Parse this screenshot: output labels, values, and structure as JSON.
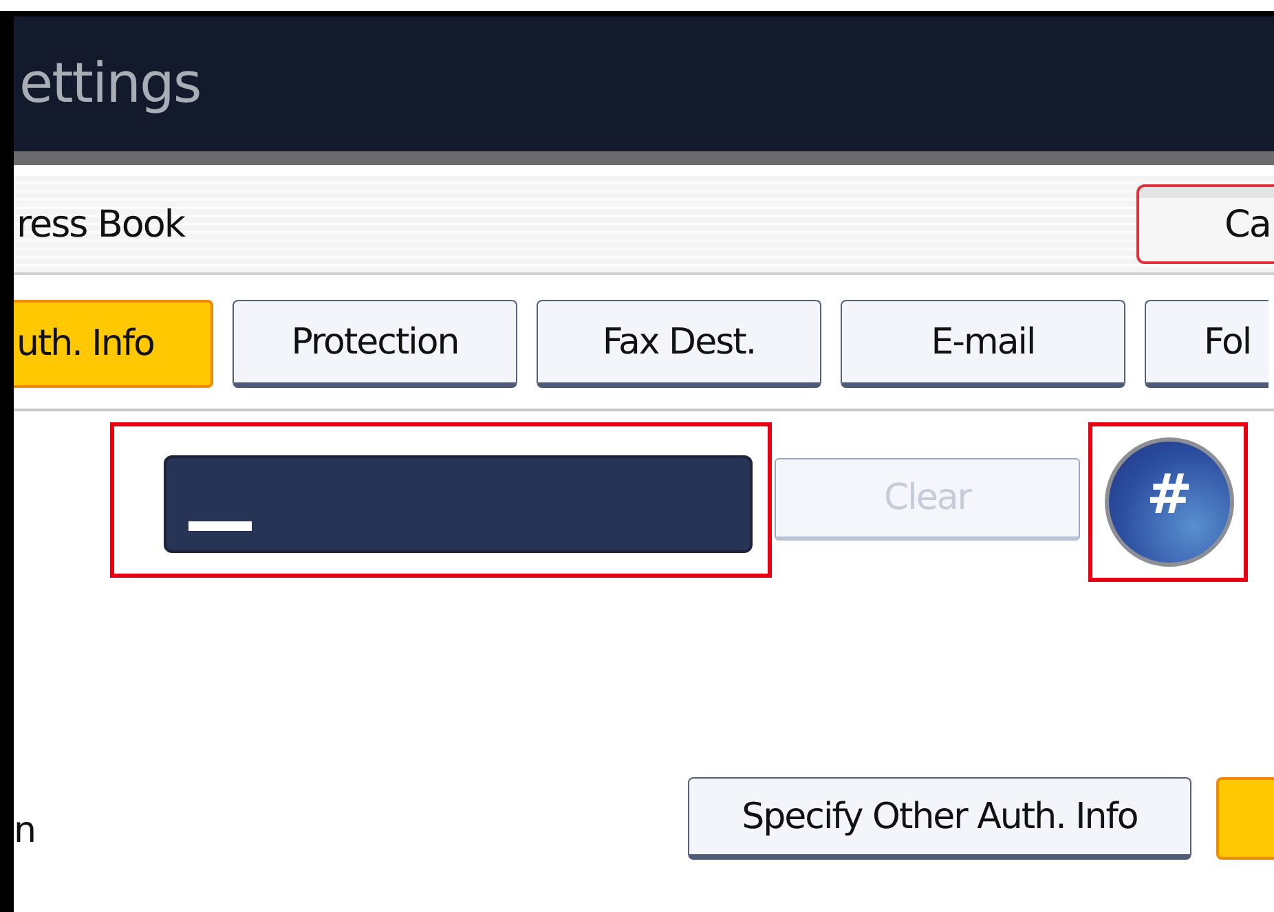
{
  "title": "ettings",
  "address_bar": {
    "label": "ress Book",
    "button": "Ca"
  },
  "tabs": [
    {
      "label": "uth. Info",
      "selected": true
    },
    {
      "label": "Protection",
      "selected": false
    },
    {
      "label": "Fax Dest.",
      "selected": false
    },
    {
      "label": "E-mail",
      "selected": false
    },
    {
      "label": "Fol",
      "selected": false
    }
  ],
  "entry": {
    "highlighted": true,
    "cursor": true
  },
  "clear_button": {
    "label": "Clear",
    "disabled": true
  },
  "hash_key": {
    "label": "#",
    "highlighted": true
  },
  "row_label": "n",
  "specify_button": {
    "label": "Specify Other Auth. Info"
  }
}
